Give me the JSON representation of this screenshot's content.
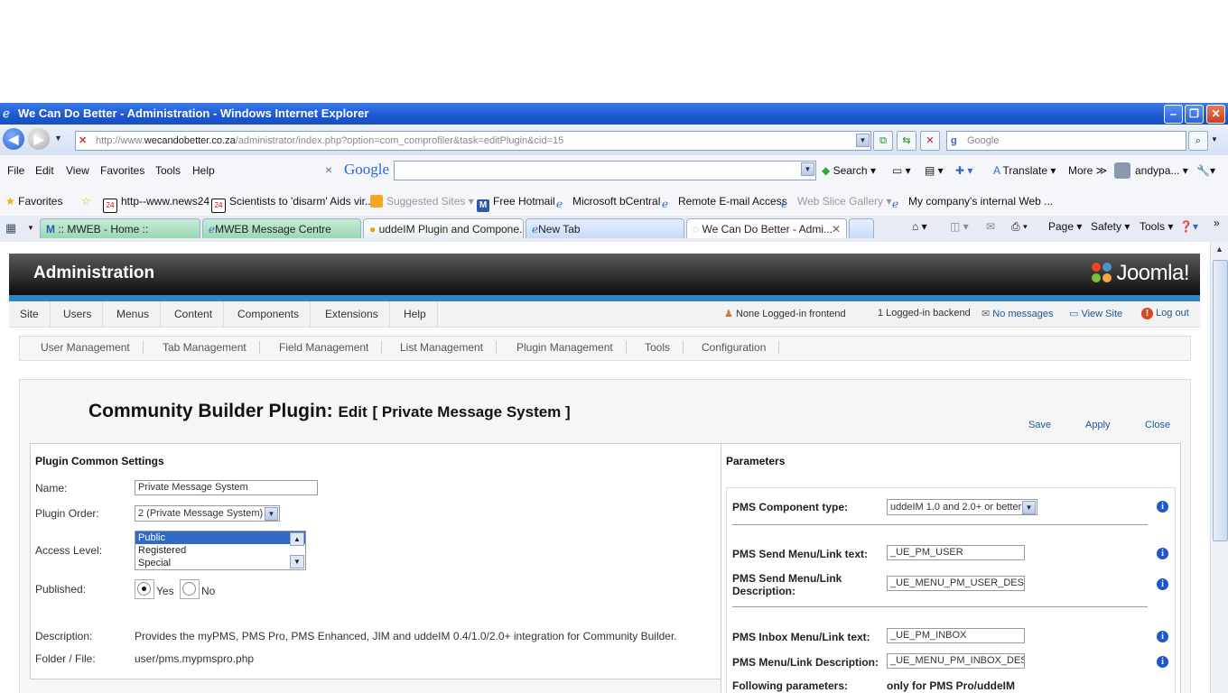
{
  "browser": {
    "window_title": "We Can Do Better - Administration - Windows Internet Explorer",
    "url_prefix": "http://www.",
    "url_domain": "wecandobetter.co.za",
    "url_rest": "/administrator/index.php?option=com_comprofiler&task=editPlugin&cid=15",
    "search_placeholder": "Google",
    "menu": [
      "File",
      "Edit",
      "View",
      "Favorites",
      "Tools",
      "Help"
    ],
    "google_bar": {
      "logo": "Google",
      "search": "Search",
      "translate": "Translate",
      "more": "More ≫",
      "user": "andypa..."
    },
    "favorites_label": "Favorites",
    "favorites": [
      "http--www.news24",
      "Scientists to 'disarm' Aids vir...",
      "Suggested Sites",
      "Free Hotmail",
      "Microsoft bCentral",
      "Remote E-mail Access",
      "Web Slice Gallery",
      "My company's internal Web ..."
    ],
    "tabs": [
      ":: MWEB - Home ::",
      "MWEB Message Centre",
      "uddeIM Plugin and Compone...",
      "New Tab",
      "We Can Do Better - Admi..."
    ],
    "commands": {
      "page": "Page",
      "safety": "Safety",
      "tools": "Tools"
    }
  },
  "admin": {
    "header_title": "Administration",
    "logo_text": "Joomla!",
    "menu": [
      "Site",
      "Users",
      "Menus",
      "Content",
      "Components",
      "Extensions",
      "Help"
    ],
    "status": {
      "frontend": "None Logged-in frontend",
      "backend": "1 Logged-in backend",
      "messages": "No messages",
      "view_site": "View Site",
      "logout": "Log out"
    },
    "submenu": [
      "User Management",
      "Tab Management",
      "Field Management",
      "List Management",
      "Plugin Management",
      "Tools",
      "Configuration"
    ]
  },
  "page": {
    "title_main": "Community Builder Plugin:",
    "title_edit": "Edit",
    "title_bracket": "[ Private Message System ]",
    "toolbar": {
      "save": "Save",
      "apply": "Apply",
      "close": "Close"
    }
  },
  "common": {
    "heading": "Plugin Common Settings",
    "name_label": "Name:",
    "name_value": "Private Message System",
    "order_label": "Plugin Order:",
    "order_value": "2 (Private Message System)",
    "access_label": "Access Level:",
    "access_options": [
      "Public",
      "Registered",
      "Special"
    ],
    "published_label": "Published:",
    "published_yes": "Yes",
    "published_no": "No",
    "description_label": "Description:",
    "description_value": "Provides the myPMS, PMS Pro, PMS Enhanced, JIM and uddeIM 0.4/1.0/2.0+ integration for Community Builder.",
    "folder_label": "Folder / File:",
    "folder_value": "user/pms.mypmspro.php"
  },
  "params": {
    "heading": "Parameters",
    "component_type_label": "PMS Component type:",
    "component_type_value": "uddeIM 1.0 and 2.0+ or better",
    "send_text_label": "PMS Send Menu/Link text:",
    "send_text_value": "_UE_PM_USER",
    "send_desc_label_1": "PMS Send Menu/Link",
    "send_desc_label_2": "Description:",
    "send_desc_value": "_UE_MENU_PM_USER_DESC",
    "inbox_text_label": "PMS Inbox Menu/Link text:",
    "inbox_text_value": "_UE_PM_INBOX",
    "inbox_desc_label": "PMS Menu/Link Description:",
    "inbox_desc_value": "_UE_MENU_PM_INBOX_DESC",
    "following_label": "Following parameters:",
    "following_value": "only for PMS Pro/uddeIM"
  }
}
